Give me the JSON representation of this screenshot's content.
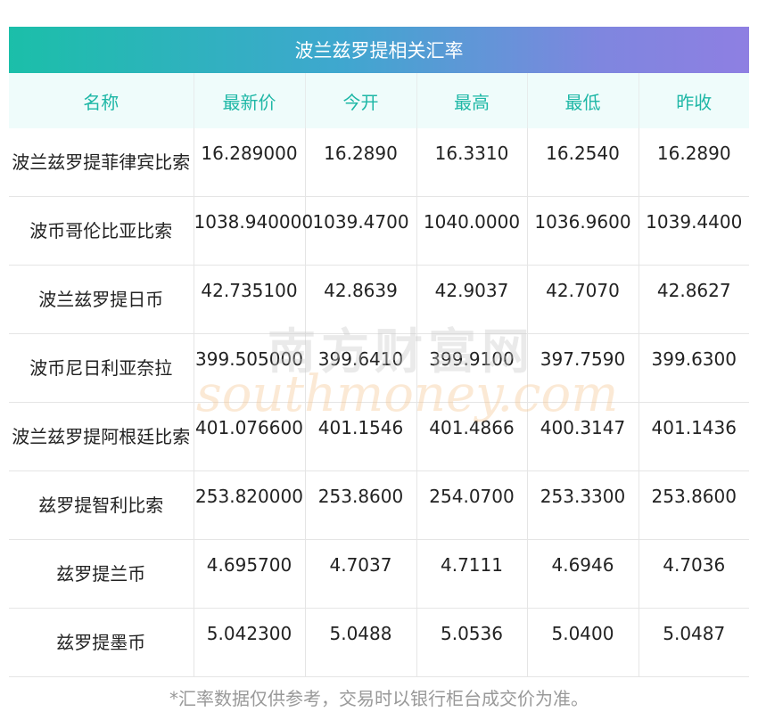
{
  "title": "波兰兹罗提相关汇率",
  "headers": [
    "名称",
    "最新价",
    "今开",
    "最高",
    "最低",
    "昨收"
  ],
  "rows": [
    {
      "name": "波兰兹罗提菲律宾比索",
      "latest": "16.289000",
      "open": "16.2890",
      "high": "16.3310",
      "low": "16.2540",
      "prev_close": "16.2890"
    },
    {
      "name": "波币哥伦比亚比索",
      "latest": "1038.940000",
      "open": "1039.4700",
      "high": "1040.0000",
      "low": "1036.9600",
      "prev_close": "1039.4400"
    },
    {
      "name": "波兰兹罗提日币",
      "latest": "42.735100",
      "open": "42.8639",
      "high": "42.9037",
      "low": "42.7070",
      "prev_close": "42.8627"
    },
    {
      "name": "波币尼日利亚奈拉",
      "latest": "399.505000",
      "open": "399.6410",
      "high": "399.9100",
      "low": "397.7590",
      "prev_close": "399.6300"
    },
    {
      "name": "波兰兹罗提阿根廷比索",
      "latest": "401.076600",
      "open": "401.1546",
      "high": "401.4866",
      "low": "400.3147",
      "prev_close": "401.1436"
    },
    {
      "name": "兹罗提智利比索",
      "latest": "253.820000",
      "open": "253.8600",
      "high": "254.0700",
      "low": "253.3300",
      "prev_close": "253.8600"
    },
    {
      "name": "兹罗提兰币",
      "latest": "4.695700",
      "open": "4.7037",
      "high": "4.7111",
      "low": "4.6946",
      "prev_close": "4.7036"
    },
    {
      "name": "兹罗提墨币",
      "latest": "5.042300",
      "open": "5.0488",
      "high": "5.0536",
      "low": "5.0400",
      "prev_close": "5.0487"
    }
  ],
  "watermark": {
    "cn": "南方财富网",
    "en": "southmoney.com"
  },
  "footnote": "*汇率数据仅供参考，交易时以银行柜台成交价为准。",
  "colors": {
    "header_text": "#1eb7a6",
    "header_bg": "#effcfb",
    "title_gradient_start": "#1bbfa9",
    "title_gradient_end": "#8e7fe2"
  }
}
